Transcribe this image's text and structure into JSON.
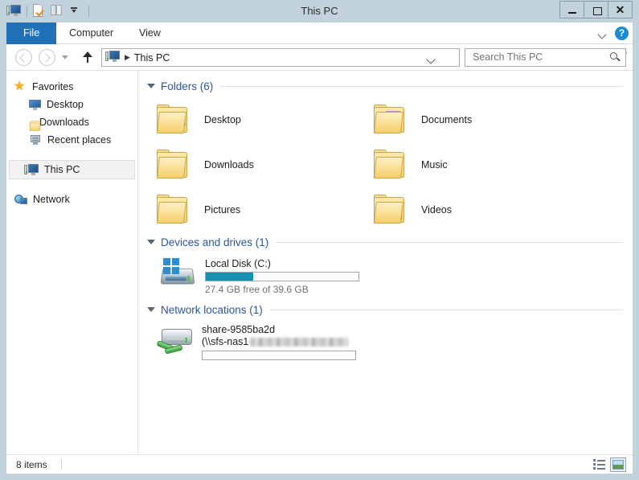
{
  "window": {
    "title": "This PC",
    "controls": {
      "minimize": "minimize-button",
      "maximize": "maximize-button",
      "close": "✕"
    }
  },
  "quick_access": {
    "items": [
      {
        "name": "computer-icon",
        "label": "This PC"
      },
      {
        "name": "properties-icon",
        "label": "Properties"
      },
      {
        "name": "new-folder-icon",
        "label": "New folder"
      },
      {
        "name": "customize-dropdown-icon",
        "label": "Customize Quick Access Toolbar"
      }
    ]
  },
  "ribbon": {
    "tabs": [
      {
        "label": "File",
        "active": true
      },
      {
        "label": "Computer",
        "active": false
      },
      {
        "label": "View",
        "active": false
      }
    ],
    "expand_label": "Expand the Ribbon",
    "help_label": "?"
  },
  "addressbar": {
    "back_label": "Back",
    "forward_label": "Forward",
    "recent_label": "Recent locations",
    "up_label": "Up one level",
    "breadcrumb": {
      "icon": "computer-icon",
      "separator": "▶",
      "label": "This PC"
    },
    "history_dropdown_label": "Previous locations",
    "refresh_label": "↻"
  },
  "search": {
    "placeholder": "Search This PC",
    "value": ""
  },
  "navpane": {
    "items": [
      {
        "label": "Favorites",
        "icon": "star-icon",
        "level": 0,
        "selected": false
      },
      {
        "label": "Desktop",
        "icon": "desktop-icon",
        "level": 1,
        "selected": false
      },
      {
        "label": "Downloads",
        "icon": "downloads-icon",
        "level": 1,
        "selected": false
      },
      {
        "label": "Recent places",
        "icon": "recent-places-icon",
        "level": 1,
        "selected": false
      },
      {
        "label": "This PC",
        "icon": "computer-icon",
        "level": 0,
        "selected": true
      },
      {
        "label": "Network",
        "icon": "network-icon",
        "level": 0,
        "selected": false
      }
    ]
  },
  "content": {
    "groups": [
      {
        "title": "Folders (6)",
        "expanded": true,
        "items": [
          {
            "label": "Desktop",
            "icon": "folder-desktop-icon"
          },
          {
            "label": "Documents",
            "icon": "folder-documents-icon"
          },
          {
            "label": "Downloads",
            "icon": "folder-downloads-icon"
          },
          {
            "label": "Music",
            "icon": "folder-music-icon"
          },
          {
            "label": "Pictures",
            "icon": "folder-pictures-icon"
          },
          {
            "label": "Videos",
            "icon": "folder-videos-icon"
          }
        ]
      },
      {
        "title": "Devices and drives (1)",
        "expanded": true,
        "drives": [
          {
            "label": "Local Disk (C:)",
            "icon": "local-disk-icon",
            "capacity_text": "27.4 GB free of 39.6 GB",
            "free_gb": 27.4,
            "total_gb": 39.6,
            "used_percent": 31,
            "bar_color": "#1491ac"
          }
        ]
      },
      {
        "title": "Network locations (1)",
        "expanded": true,
        "network": [
          {
            "label": "share-9585ba2d",
            "icon": "network-drive-icon",
            "path_prefix": "(\\\\sfs-nas1",
            "path_redacted": true,
            "bar_fill_percent": 0
          }
        ]
      }
    ]
  },
  "statusbar": {
    "item_count": "8 items",
    "views": [
      {
        "name": "details-view-button",
        "active": false
      },
      {
        "name": "large-icons-view-button",
        "active": true
      }
    ]
  },
  "colors": {
    "frame": "#c3d3dd",
    "file_tab": "#2071b8",
    "group_title": "#2b5797",
    "capacity_fill": "#1491ac",
    "selection": "#f2f2f2"
  }
}
